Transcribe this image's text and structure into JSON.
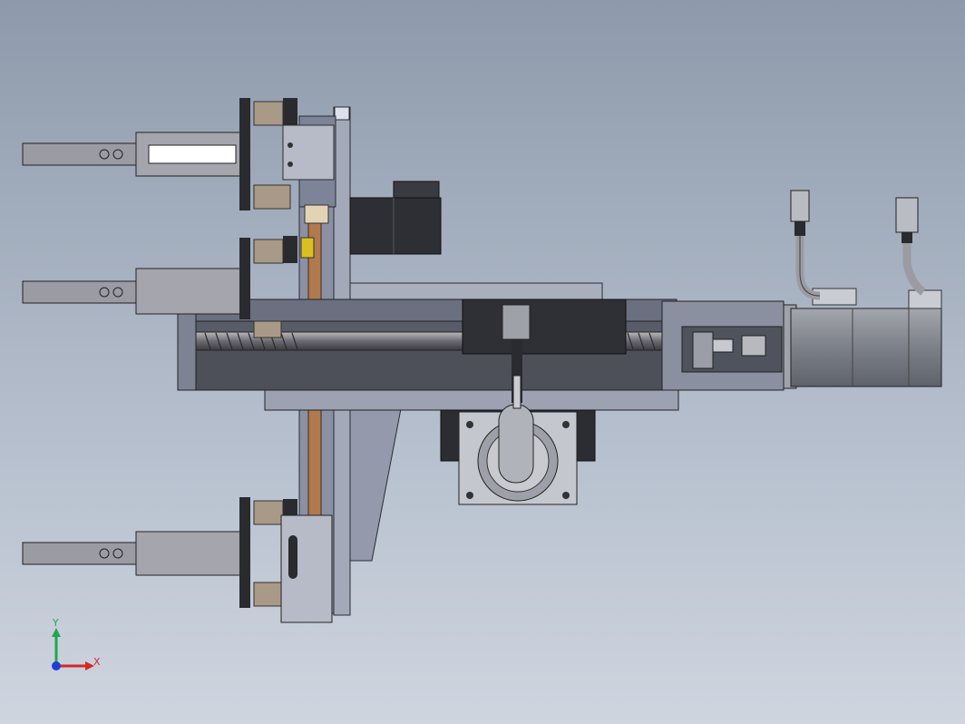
{
  "viewport": {
    "background_top": "#8e9aab",
    "background_bottom": "#cfd5df"
  },
  "triad": {
    "y_label": "Y",
    "x_label": "X",
    "y_color": "#1fa84a",
    "x_color": "#d62828",
    "z_color": "#1e3fd6"
  },
  "colors": {
    "frame": "#7b8296",
    "frame_light": "#a8aebb",
    "plate": "#9aa0b0",
    "motor": "#2e2f33",
    "motor_silver": "#8c8f96",
    "gripper": "#9b9ba3",
    "belt": "#b07a4e",
    "spring": "#a89a86",
    "yellow_tab": "#d9c021"
  },
  "icons": {
    "triad": "coordinate-triad-icon"
  }
}
